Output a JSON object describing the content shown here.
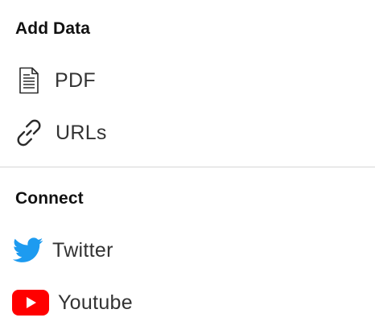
{
  "add_data": {
    "title": "Add Data",
    "items": [
      {
        "label": "PDF",
        "icon": "document-icon"
      },
      {
        "label": "URLs",
        "icon": "link-icon"
      }
    ]
  },
  "connect": {
    "title": "Connect",
    "items": [
      {
        "label": "Twitter",
        "icon": "twitter-icon",
        "color": "#1d9bf0"
      },
      {
        "label": "Youtube",
        "icon": "youtube-icon",
        "color": "#ff0000"
      }
    ]
  }
}
